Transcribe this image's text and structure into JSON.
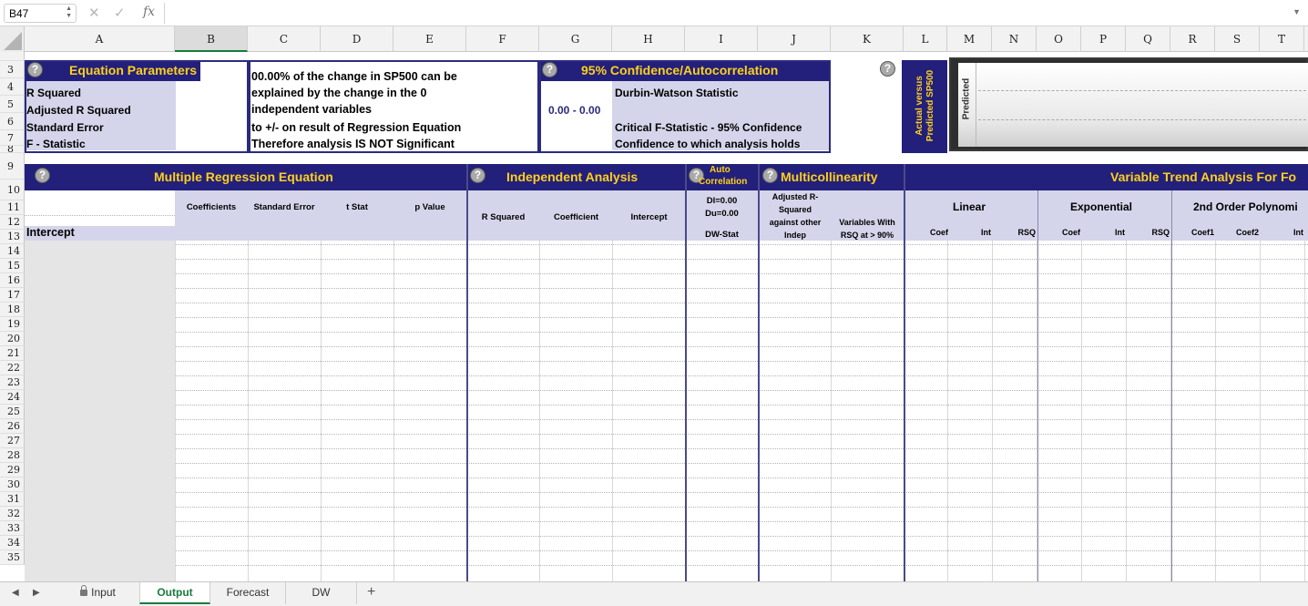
{
  "formula_bar": {
    "name_box": "B47",
    "cancel_icon": "✕",
    "enter_icon": "✓",
    "fx_label": "fx",
    "formula": ""
  },
  "columns": [
    "A",
    "B",
    "C",
    "D",
    "E",
    "F",
    "G",
    "H",
    "I",
    "J",
    "K",
    "L",
    "M",
    "N",
    "O",
    "P",
    "Q",
    "R",
    "S",
    "T"
  ],
  "selected_column": "B",
  "rows": [
    "3",
    "4",
    "5",
    "6",
    "7",
    "8",
    "9",
    "10",
    "11",
    "12",
    "13",
    "14",
    "15",
    "16",
    "17",
    "18",
    "19",
    "20",
    "21",
    "22",
    "23",
    "24",
    "25",
    "26",
    "27",
    "28",
    "29",
    "30",
    "31",
    "32",
    "33",
    "34",
    "35"
  ],
  "equation_parameters": {
    "help": "?",
    "title": "Equation Parameters",
    "labels": [
      "R Squared",
      "Adjusted R Squared",
      "Standard Error",
      "F - Statistic"
    ]
  },
  "explanation": {
    "lines": [
      "00.00% of the change in SP500 can be",
      "explained by the change in the 0",
      "independent variables",
      "to +/- on result of Regression Equation",
      "Therefore analysis IS NOT Significant"
    ]
  },
  "confidence": {
    "help": "?",
    "title": "95% Confidence/Autocorrelation",
    "range_value": "0.00 - 0.00",
    "labels": [
      "Durbin-Watson Statistic",
      "Critical F-Statistic - 95% Confidence",
      "Confidence to which analysis holds"
    ]
  },
  "chart": {
    "help": "?",
    "vertical_title_line1": "Actual versus",
    "vertical_title_line2": "Predicted SP500",
    "axis_label": "Predicted",
    "colors": {
      "navy": "#22207a",
      "title_yellow": "#ffcf1f"
    }
  },
  "sections": {
    "multiple_regression": {
      "help": "?",
      "title": "Multiple Regression Equation"
    },
    "independent_analysis": {
      "help": "?",
      "title": "Independent Analysis"
    },
    "autocorrelation": {
      "help": "?",
      "title_line1": "Auto",
      "title_line2": "Correlation"
    },
    "multicollinearity": {
      "help": "?",
      "title": "Multicollinearity"
    },
    "trend": {
      "title": "Variable Trend Analysis For Fo"
    }
  },
  "headers": {
    "coefficients": "Coefficients",
    "standard_error": "Standard Error",
    "t_stat": "t Stat",
    "p_value": "p Value",
    "r_squared": "R Squared",
    "coefficient": "Coefficient",
    "intercept": "Intercept",
    "dl": "Dl=0.00",
    "du": "Du=0.00",
    "dw_stat": "DW-Stat",
    "adj_r_squared_lines": [
      "Adjusted R-",
      "Squared",
      "against other",
      "Indep"
    ],
    "variables_with_lines": [
      "Variables With",
      "RSQ at > 90%"
    ],
    "linear": "Linear",
    "exponential": "Exponential",
    "poly": "2nd Order Polynomi",
    "coef": "Coef",
    "int": "Int",
    "rsq": "RSQ",
    "coef1": "Coef1",
    "coef2": "Coef2"
  },
  "intercept_label": "Intercept",
  "sheet_tabs": [
    "Input",
    "Output",
    "Forecast",
    "DW"
  ],
  "active_tab": "Output",
  "add_sheet": "+"
}
